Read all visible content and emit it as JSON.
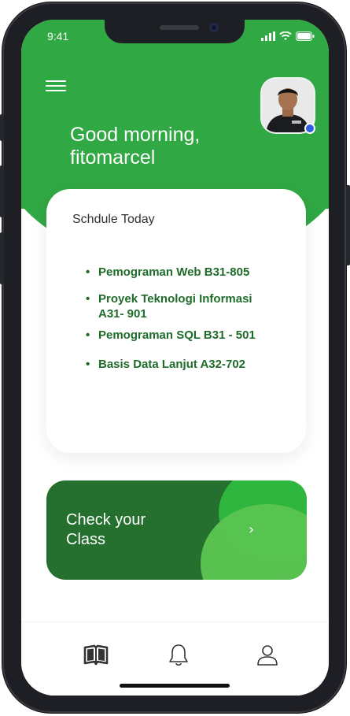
{
  "status_bar": {
    "time": "9:41"
  },
  "header": {
    "greeting_line1": "Good morning,",
    "greeting_line2": "fitomarcel"
  },
  "schedule": {
    "title": "Schdule Today",
    "items": [
      {
        "line1": "Pemograman Web B31-805",
        "line2": ""
      },
      {
        "line1": "Proyek Teknologi Informasi",
        "line2": "A31- 901"
      },
      {
        "line1": "Pemograman SQL  B31 - 501",
        "line2": ""
      },
      {
        "line1": "Basis Data Lanjut A32-702",
        "line2": ""
      }
    ]
  },
  "class_card": {
    "line1": "Check your",
    "line2": "Class",
    "chevron": "›"
  },
  "nav": {
    "items": [
      {
        "icon": "book-icon"
      },
      {
        "icon": "bell-icon"
      },
      {
        "icon": "user-icon"
      }
    ]
  },
  "colors": {
    "primary": "#30a843",
    "dark_green": "#25702f",
    "text_green": "#1e6b2a",
    "online_dot": "#2d5fe0"
  }
}
